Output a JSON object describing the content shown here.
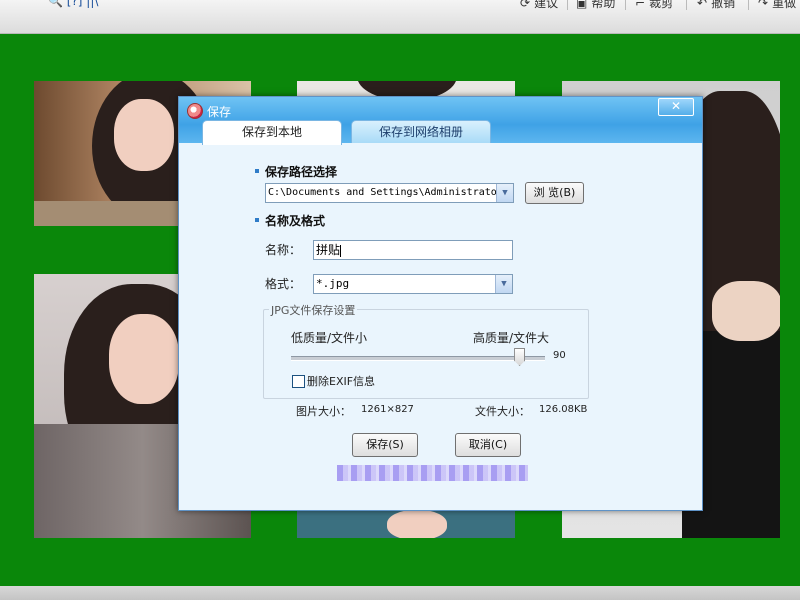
{
  "topbar": {
    "left_text": "🔍 [?] ||\\",
    "items": [
      {
        "label": "建议",
        "icon": "sync-icon"
      },
      {
        "label": "帮助",
        "icon": "help-icon"
      },
      {
        "label": "裁剪",
        "icon": "crop-icon"
      },
      {
        "label": "撤销",
        "icon": "undo-icon"
      },
      {
        "label": "重做",
        "icon": "redo-icon"
      }
    ]
  },
  "canvas": {
    "background": "#0a870a"
  },
  "dialog": {
    "title": "保存",
    "close_label": "✕",
    "tabs": [
      {
        "label": "保存到本地",
        "active": true
      },
      {
        "label": "保存到网络相册",
        "active": false
      }
    ],
    "path_section": {
      "title": "保存路径选择",
      "path_value": "C:\\Documents and Settings\\Administrator\\...",
      "browse_label": "浏 览(B)"
    },
    "format_section": {
      "title": "名称及格式",
      "name_label": "名称：",
      "name_value": "拼贴",
      "format_label": "格式：",
      "format_value": "*.jpg"
    },
    "jpg_settings": {
      "title": "JPG文件保存设置",
      "low_label": "低质量/文件小",
      "high_label": "高质量/文件大",
      "quality_value": "90",
      "quality_fraction": 0.9,
      "exif_label": "删除EXIF信息",
      "exif_checked": false
    },
    "info": {
      "size_label": "图片大小：",
      "size_value": "1261×827",
      "filesize_label": "文件大小：",
      "filesize_value": "126.08KB"
    },
    "buttons": {
      "save": "保存(S)",
      "cancel": "取消(C)"
    }
  }
}
